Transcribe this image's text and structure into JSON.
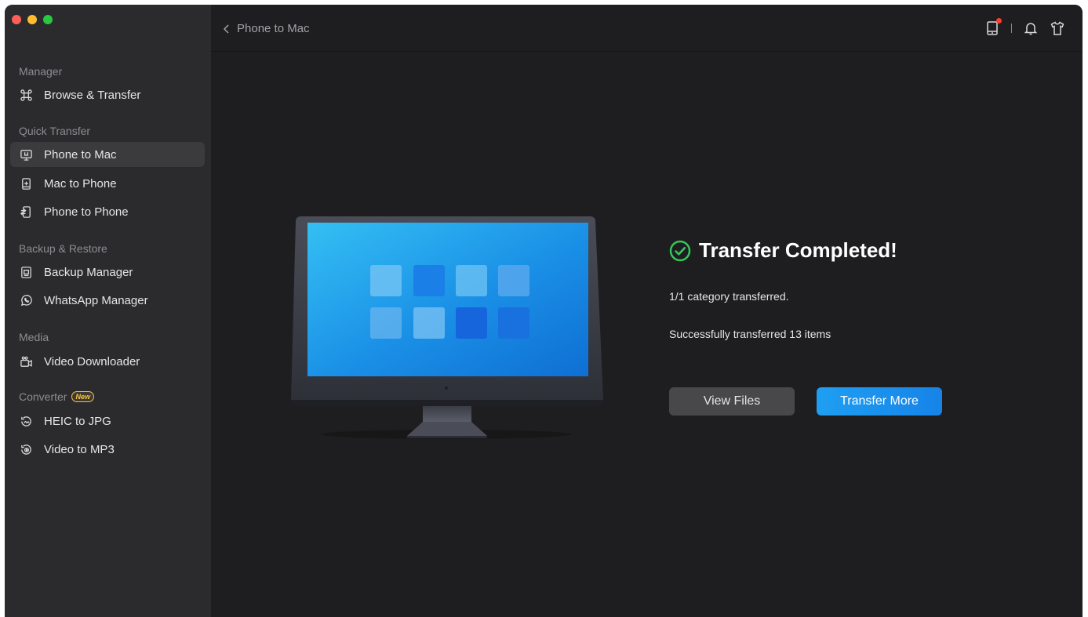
{
  "colors": {
    "accent": "#1a8ff0",
    "success": "#33c75a",
    "sidebar_bg": "#2b2b2d",
    "main_bg": "#1e1e20",
    "new_badge": "#f6c344",
    "traffic_close": "#fe5f57",
    "traffic_min": "#febc2e",
    "traffic_max": "#28c840"
  },
  "sidebar": {
    "sections": {
      "manager": "Manager",
      "quick_transfer": "Quick Transfer",
      "backup_restore": "Backup & Restore",
      "media": "Media",
      "converter": "Converter",
      "converter_badge": "New"
    },
    "items": {
      "browse_transfer": {
        "label": "Browse & Transfer",
        "icon": "command-icon"
      },
      "phone_to_mac": {
        "label": "Phone to Mac",
        "icon": "monitor-phone-icon",
        "active": true
      },
      "mac_to_phone": {
        "label": "Mac to Phone",
        "icon": "phone-add-icon"
      },
      "phone_to_phone": {
        "label": "Phone to Phone",
        "icon": "phones-transfer-icon"
      },
      "backup_manager": {
        "label": "Backup Manager",
        "icon": "backup-icon"
      },
      "whatsapp_manager": {
        "label": "WhatsApp Manager",
        "icon": "whatsapp-icon"
      },
      "video_downloader": {
        "label": "Video Downloader",
        "icon": "video-camera-icon"
      },
      "heic_to_jpg": {
        "label": "HEIC to JPG",
        "icon": "image-convert-icon"
      },
      "video_to_mp3": {
        "label": "Video to MP3",
        "icon": "audio-convert-icon"
      }
    }
  },
  "header": {
    "breadcrumb": "Phone to Mac",
    "icons": [
      "device-icon",
      "bell-icon",
      "tshirt-icon"
    ]
  },
  "result": {
    "title": "Transfer Completed!",
    "category_line": "1/1 category transferred.",
    "items_line": "Successfully transferred 13 items",
    "view_files_label": "View Files",
    "transfer_more_label": "Transfer More"
  }
}
